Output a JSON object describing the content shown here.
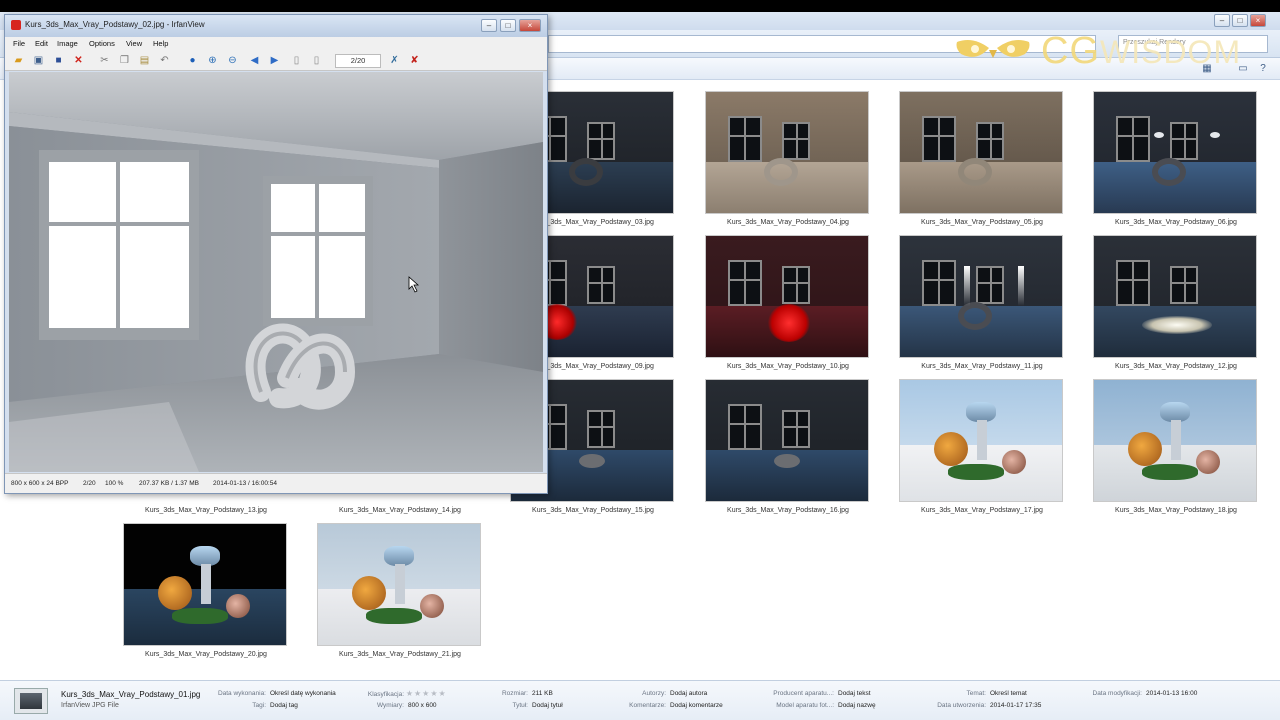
{
  "explorer": {
    "search_placeholder": "Przeszukaj Rendery",
    "thumbnails": [
      {
        "name": "Kurs_3ds_Max_Vray_Podstawy_03.jpg",
        "scene": "dark-room"
      },
      {
        "name": "Kurs_3ds_Max_Vray_Podstawy_04.jpg",
        "scene": "warm-room"
      },
      {
        "name": "Kurs_3ds_Max_Vray_Podstawy_05.jpg",
        "scene": "warm-room-2"
      },
      {
        "name": "Kurs_3ds_Max_Vray_Podstawy_06.jpg",
        "scene": "wall-lights"
      },
      {
        "name": "Kurs_3ds_Max_Vray_Podstawy_09.jpg",
        "scene": "red-glow"
      },
      {
        "name": "Kurs_3ds_Max_Vray_Podstawy_10.jpg",
        "scene": "red-room"
      },
      {
        "name": "Kurs_3ds_Max_Vray_Podstawy_11.jpg",
        "scene": "spotlights"
      },
      {
        "name": "Kurs_3ds_Max_Vray_Podstawy_12.jpg",
        "scene": "pool-light"
      },
      {
        "name": "Kurs_3ds_Max_Vray_Podstawy_13.jpg",
        "scene": "hidden"
      },
      {
        "name": "Kurs_3ds_Max_Vray_Podstawy_14.jpg",
        "scene": "hidden"
      },
      {
        "name": "Kurs_3ds_Max_Vray_Podstawy_15.jpg",
        "scene": "dark-room-floor"
      },
      {
        "name": "Kurs_3ds_Max_Vray_Podstawy_16.jpg",
        "scene": "dark-room-floor"
      },
      {
        "name": "Kurs_3ds_Max_Vray_Podstawy_17.jpg",
        "scene": "objects-day"
      },
      {
        "name": "Kurs_3ds_Max_Vray_Podstawy_18.jpg",
        "scene": "objects-day-2"
      },
      {
        "name": "Kurs_3ds_Max_Vray_Podstawy_20.jpg",
        "scene": "objects-night"
      },
      {
        "name": "Kurs_3ds_Max_Vray_Podstawy_21.jpg",
        "scene": "objects-sky"
      }
    ]
  },
  "logo": {
    "brand_a": "CG",
    "brand_b": "WISDOM"
  },
  "irfanview": {
    "title": "Kurs_3ds_Max_Vray_Podstawy_02.jpg - IrfanView",
    "menu": [
      "File",
      "Edit",
      "Image",
      "Options",
      "View",
      "Help"
    ],
    "counter": "2/20",
    "status": {
      "dims": "800 x 600 x 24 BPP",
      "index": "2/20",
      "zoom": "100 %",
      "size": "207.37 KB / 1.37 MB",
      "date": "2014-01-13 / 16:00:54"
    }
  },
  "details": {
    "file_name": "Kurs_3ds_Max_Vray_Podstawy_01.jpg",
    "file_type": "IrfanView JPG File",
    "props": [
      {
        "k": "Data wykonania:",
        "v": "Określ datę wykonania"
      },
      {
        "k": "Tagi:",
        "v": "Dodaj tag"
      },
      {
        "k": "Klasyfikacja:",
        "v": ""
      },
      {
        "k": "Wymiary:",
        "v": "800 x 600"
      },
      {
        "k": "Rozmiar:",
        "v": "211 KB"
      },
      {
        "k": "Tytuł:",
        "v": "Dodaj tytuł"
      },
      {
        "k": "Autorzy:",
        "v": "Dodaj autora"
      },
      {
        "k": "Komentarze:",
        "v": "Dodaj komentarze"
      },
      {
        "k": "Producent aparatu...:",
        "v": "Dodaj tekst"
      },
      {
        "k": "Model aparatu fot...:",
        "v": "Dodaj nazwę"
      },
      {
        "k": "Temat:",
        "v": "Określ temat"
      },
      {
        "k": "Data utworzenia:",
        "v": "2014-01-17 17:35"
      },
      {
        "k": "Data modyfikacji:",
        "v": "2014-01-13 16:00"
      }
    ]
  }
}
